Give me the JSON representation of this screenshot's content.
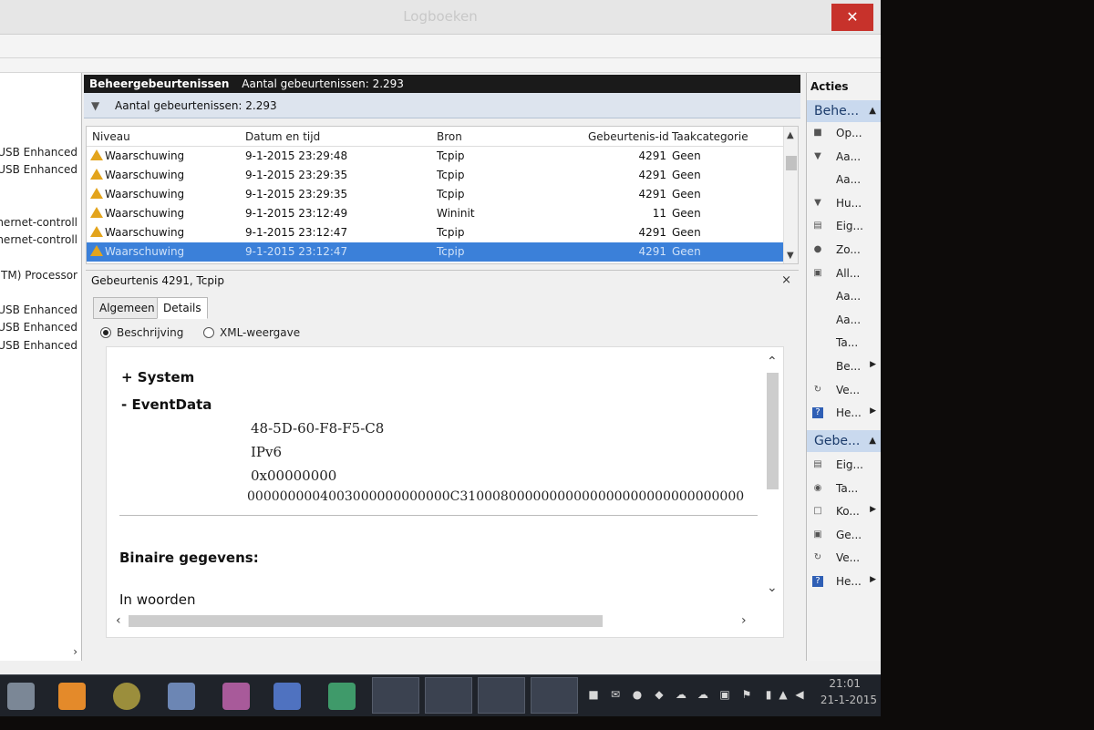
{
  "window": {
    "title": "Logboeken",
    "close_glyph": "✕"
  },
  "tree": {
    "items": [
      "USB Enhanced",
      "USB Enhanced",
      "hernet-controll",
      "hernet-controll",
      "TM) Processor",
      "USB Enhanced",
      "USB Enhanced",
      "USB Enhanced"
    ],
    "scroll_glyph": "›"
  },
  "list": {
    "header_title": "Beheergebeurtenissen",
    "header_count": "Aantal gebeurtenissen: 2.293",
    "filter_text": "Aantal gebeurtenissen: 2.293",
    "columns": [
      "Niveau",
      "Datum en tijd",
      "Bron",
      "Gebeurtenis-id",
      "Taakcategorie"
    ],
    "rows": [
      {
        "level": "Waarschuwing",
        "datetime": "9-1-2015 23:29:48",
        "source": "Tcpip",
        "id": "4291",
        "category": "Geen"
      },
      {
        "level": "Waarschuwing",
        "datetime": "9-1-2015 23:29:35",
        "source": "Tcpip",
        "id": "4291",
        "category": "Geen"
      },
      {
        "level": "Waarschuwing",
        "datetime": "9-1-2015 23:29:35",
        "source": "Tcpip",
        "id": "4291",
        "category": "Geen"
      },
      {
        "level": "Waarschuwing",
        "datetime": "9-1-2015 23:12:49",
        "source": "Wininit",
        "id": "11",
        "category": "Geen"
      },
      {
        "level": "Waarschuwing",
        "datetime": "9-1-2015 23:12:47",
        "source": "Tcpip",
        "id": "4291",
        "category": "Geen"
      },
      {
        "level": "Waarschuwing",
        "datetime": "9-1-2015 23:12:47",
        "source": "Tcpip",
        "id": "4291",
        "category": "Geen"
      }
    ],
    "selected_row": 5
  },
  "detail": {
    "title": "Gebeurtenis 4291, Tcpip",
    "close_glyph": "×",
    "tabs": [
      "Algemeen",
      "Details"
    ],
    "active_tab": "Details",
    "radio_options": [
      "Beschrijving",
      "XML-weergave"
    ],
    "selected_radio": "Beschrijving",
    "xml": {
      "system_label": "+ System",
      "eventdata_label": "-  EventData",
      "values": [
        "48-5D-60-F8-F5-C8",
        "IPv6",
        "0x00000000",
        "0000000004003000000000000C31000800000000000000000000000000000"
      ],
      "binary_label": "Binaire gegevens:",
      "words_label": "In woorden"
    }
  },
  "actions": {
    "title": "Acties",
    "section1": "Behe...",
    "section1_items": [
      {
        "label": "Op...",
        "icon": "folder-icon"
      },
      {
        "label": "Aa...",
        "icon": "filter-icon"
      },
      {
        "label": "Aa...",
        "icon": "blank"
      },
      {
        "label": "Hu...",
        "icon": "filter-icon"
      },
      {
        "label": "Eig...",
        "icon": "properties-icon"
      },
      {
        "label": "Zo...",
        "icon": "binoculars-icon"
      },
      {
        "label": "All...",
        "icon": "save-icon"
      },
      {
        "label": "Aa...",
        "icon": "blank"
      },
      {
        "label": "Aa...",
        "icon": "blank"
      },
      {
        "label": "Ta...",
        "icon": "blank"
      },
      {
        "label": "Be...",
        "icon": "blank",
        "submenu": true
      },
      {
        "label": "Ve...",
        "icon": "refresh-icon"
      },
      {
        "label": "He...",
        "icon": "help-icon",
        "submenu": true
      }
    ],
    "section2": "Gebe...",
    "section2_items": [
      {
        "label": "Eig...",
        "icon": "properties-icon"
      },
      {
        "label": "Ta...",
        "icon": "task-icon"
      },
      {
        "label": "Ko...",
        "icon": "copy-icon",
        "submenu": true
      },
      {
        "label": "Ge...",
        "icon": "save-icon"
      },
      {
        "label": "Ve...",
        "icon": "refresh-icon"
      },
      {
        "label": "He...",
        "icon": "help-icon",
        "submenu": true
      }
    ]
  },
  "taskbar": {
    "time": "21:01",
    "date": "21-1-2015"
  },
  "colors": {
    "selection": "#3b80d9",
    "warning": "#e3a41c",
    "close": "#c7322b",
    "action_section": "#c9d9ee"
  }
}
